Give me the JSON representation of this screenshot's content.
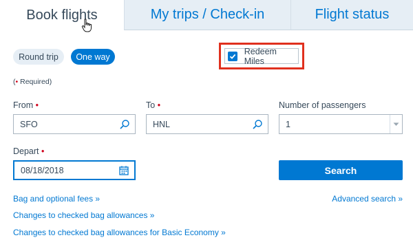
{
  "tabs": [
    {
      "label": "Book flights"
    },
    {
      "label": "My trips / Check-in"
    },
    {
      "label": "Flight status"
    }
  ],
  "trip_type": {
    "round_trip_label": "Round trip",
    "one_way_label": "One way",
    "selected": "One way"
  },
  "redeem": {
    "label": "Redeem Miles",
    "checked": true
  },
  "required_note": {
    "open": "(",
    "dot": "•",
    "text": " Required)"
  },
  "form": {
    "from": {
      "label": "From",
      "required_mark": "•",
      "value": "SFO"
    },
    "to": {
      "label": "To",
      "required_mark": "•",
      "value": "HNL"
    },
    "passengers": {
      "label": "Number of passengers",
      "value": "1"
    },
    "depart": {
      "label": "Depart",
      "required_mark": "•",
      "value": "08/18/2018"
    },
    "search_label": "Search"
  },
  "links": {
    "bag_fees": "Bag and optional fees »",
    "advanced_search": "Advanced search »",
    "checked_bag_changes": "Changes to checked bag allowances »",
    "basic_economy_changes": "Changes to checked bag allowances for Basic Economy »"
  },
  "colors": {
    "brand_blue": "#0078d2",
    "highlight_red": "#e0301e",
    "text": "#36495a"
  },
  "icons": {
    "from_field": "magnifier-icon",
    "to_field": "magnifier-icon",
    "passengers": "chevron-down-icon",
    "depart_field": "calendar-icon",
    "cursor": "hand-pointer-icon"
  }
}
